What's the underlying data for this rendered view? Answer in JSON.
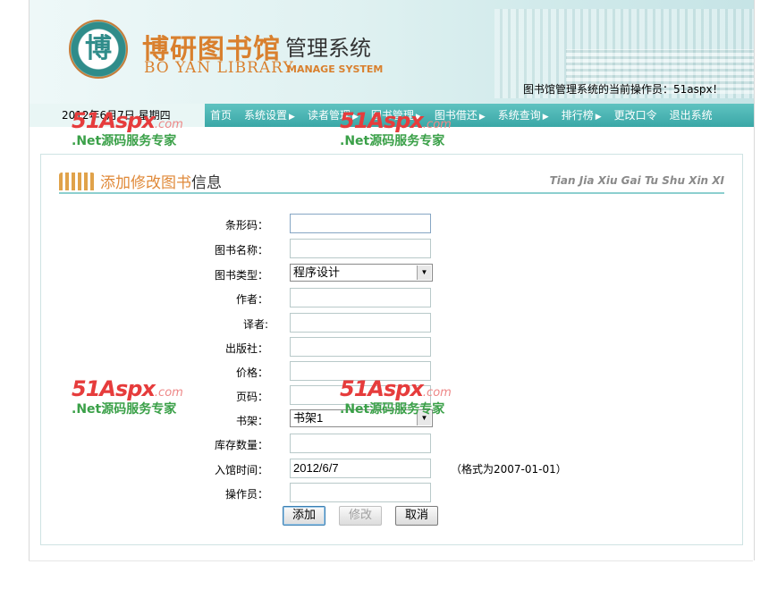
{
  "header": {
    "logo_char": "博",
    "logo_cn": "博研图书馆",
    "logo_system": "管理系统",
    "logo_en": "BO YAN LIBRARY",
    "logo_en_system": "MANAGE SYSTEM",
    "operator_text": "图书馆管理系统的当前操作员：51aspx！"
  },
  "nav": {
    "date": "2012年6月7日 星期四",
    "items": [
      {
        "label": "首页",
        "arrow": ""
      },
      {
        "label": "系统设置",
        "arrow": "▶"
      },
      {
        "label": "读者管理",
        "arrow": "▶"
      },
      {
        "label": "图书管理",
        "arrow": "▶"
      },
      {
        "label": "图书借还",
        "arrow": "▶"
      },
      {
        "label": "系统查询",
        "arrow": "▶"
      },
      {
        "label": "排行榜",
        "arrow": "▶"
      },
      {
        "label": "更改口令",
        "arrow": ""
      },
      {
        "label": "退出系统",
        "arrow": ""
      }
    ]
  },
  "watermark": {
    "brand": "51Aspx",
    "domain": ".com",
    "tagline": ".Net源码服务专家"
  },
  "panel": {
    "title_cn_colored": "添加修改图书",
    "title_cn_plain": "信息",
    "title_en": "Tian Jia Xiu Gai Tu Shu Xin XI"
  },
  "form": {
    "barcode_label": "条形码：",
    "barcode_value": "",
    "name_label": "图书名称：",
    "name_value": "",
    "type_label": "图书类型：",
    "type_value": "程序设计",
    "author_label": "作者：",
    "author_value": "",
    "translator_label": "译者:",
    "translator_value": "",
    "publisher_label": "出版社：",
    "publisher_value": "",
    "price_label": "价格：",
    "price_value": "",
    "pages_label": "页码：",
    "pages_value": "",
    "shelf_label": "书架：",
    "shelf_value": "书架1",
    "stock_label": "库存数量：",
    "stock_value": "",
    "date_label": "入馆时间：",
    "date_value": "2012/6/7",
    "date_hint": "（格式为2007-01-01）",
    "operator_label": "操作员：",
    "operator_value": ""
  },
  "buttons": {
    "add": "添加",
    "modify": "修改",
    "cancel": "取消"
  }
}
